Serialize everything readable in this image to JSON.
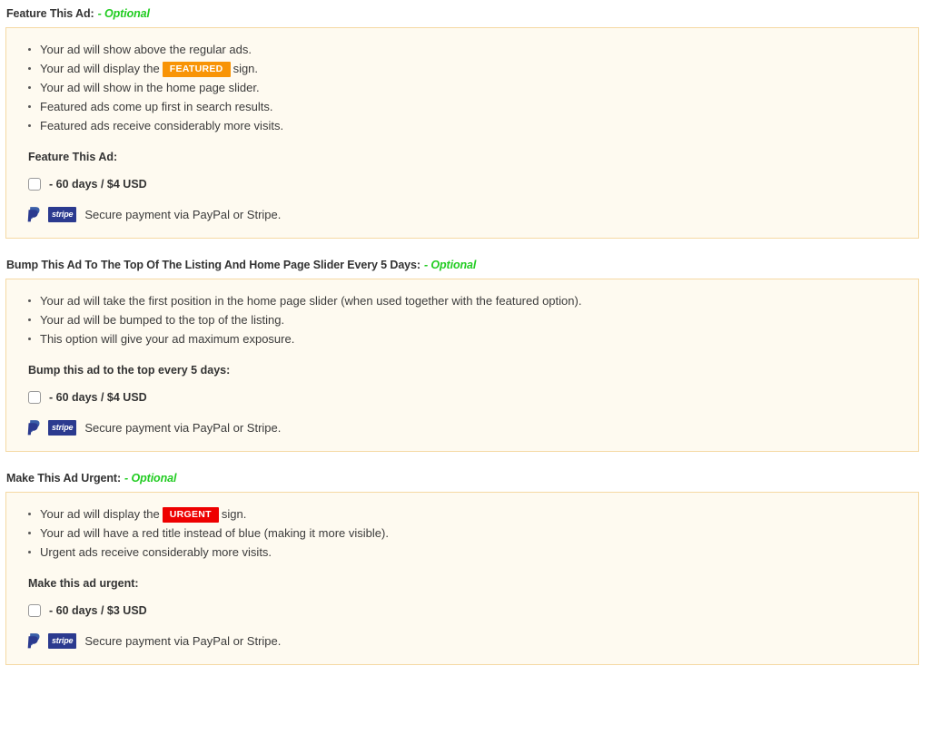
{
  "page": {
    "background_color": "#ffffff",
    "panel_background_color": "#fefaf0",
    "panel_border_color": "#f5d9a4",
    "optional_color": "#22cc22",
    "featured_badge_color": "#f89406",
    "urgent_badge_color": "#ee0000",
    "paypal_color": "#2b3a8f",
    "stripe_color": "#2b3a8f"
  },
  "sections": [
    {
      "id": "feature-this-ad",
      "heading": "Feature This Ad:",
      "optional": "- Optional",
      "benefits": [
        {
          "before": "Your ad will show above the regular ads.",
          "badge": null,
          "after": ""
        },
        {
          "before": "Your ad will display the",
          "badge": "FEATURED",
          "badge_type": "featured",
          "after": "sign."
        },
        {
          "before": "Your ad will show in the home page slider.",
          "badge": null,
          "after": ""
        },
        {
          "before": "Featured ads come up first in search results.",
          "badge": null,
          "after": ""
        },
        {
          "before": "Featured ads receive considerably more visits.",
          "badge": null,
          "after": ""
        }
      ],
      "sub_label": "Feature This Ad:",
      "checkbox_label": "- 60 days / $4 USD",
      "checkbox_checked": false,
      "payment_text": "Secure payment via PayPal or Stripe.",
      "paypal_icon": "paypal-icon",
      "stripe_icon": "stripe-icon",
      "stripe_text": "stripe"
    },
    {
      "id": "bump-this-ad",
      "heading": "Bump This Ad To The Top Of The Listing And Home Page Slider Every 5 Days:",
      "optional": "- Optional",
      "benefits": [
        {
          "before": "Your ad will take the first position in the home page slider (when used together with the featured option).",
          "badge": null,
          "after": ""
        },
        {
          "before": "Your ad will be bumped to the top of the listing.",
          "badge": null,
          "after": ""
        },
        {
          "before": "This option will give your ad maximum exposure.",
          "badge": null,
          "after": ""
        }
      ],
      "sub_label": "Bump this ad to the top every 5 days:",
      "checkbox_label": "- 60 days / $4 USD",
      "checkbox_checked": false,
      "payment_text": "Secure payment via PayPal or Stripe.",
      "paypal_icon": "paypal-icon",
      "stripe_icon": "stripe-icon",
      "stripe_text": "stripe"
    },
    {
      "id": "make-ad-urgent",
      "heading": "Make This Ad Urgent:",
      "optional": "- Optional",
      "benefits": [
        {
          "before": "Your ad will display the",
          "badge": "URGENT",
          "badge_type": "urgent",
          "after": "sign."
        },
        {
          "before": "Your ad will have a red title instead of blue (making it more visible).",
          "badge": null,
          "after": ""
        },
        {
          "before": "Urgent ads receive considerably more visits.",
          "badge": null,
          "after": ""
        }
      ],
      "sub_label": "Make this ad urgent:",
      "checkbox_label": "- 60 days / $3 USD",
      "checkbox_checked": false,
      "payment_text": "Secure payment via PayPal or Stripe.",
      "paypal_icon": "paypal-icon",
      "stripe_icon": "stripe-icon",
      "stripe_text": "stripe"
    }
  ]
}
